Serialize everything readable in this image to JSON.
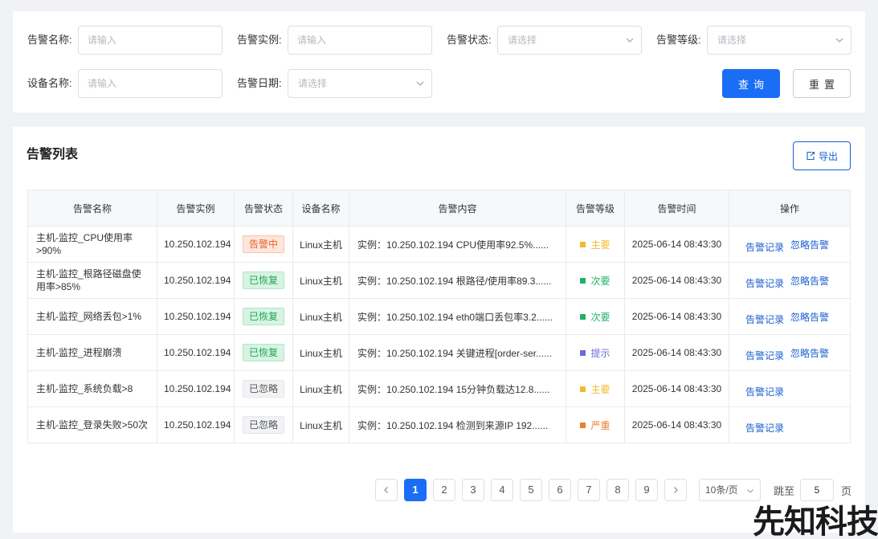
{
  "filters": {
    "alert_name": {
      "label": "告警名称:",
      "placeholder": "请输入"
    },
    "alert_instance": {
      "label": "告警实例:",
      "placeholder": "请输入"
    },
    "alert_status": {
      "label": "告警状态:",
      "placeholder": "请选择"
    },
    "alert_level": {
      "label": "告警等级:",
      "placeholder": "请选择"
    },
    "device_name": {
      "label": "设备名称:",
      "placeholder": "请输入"
    },
    "alert_date": {
      "label": "告警日期:",
      "placeholder": "请选择"
    },
    "query_label": "查询",
    "reset_label": "重置"
  },
  "list": {
    "title": "告警列表",
    "export_label": "导出",
    "columns": [
      "告警名称",
      "告警实例",
      "告警状态",
      "设备名称",
      "告警内容",
      "告警等级",
      "告警时间",
      "操作"
    ],
    "status_colors": {
      "告警中": {
        "bg": "#fde6dc",
        "border": "#f8c4ac",
        "text": "#e8642c"
      },
      "已恢复": {
        "bg": "#d7f3e1",
        "border": "#b3e6c6",
        "text": "#1ea55a"
      },
      "已忽略": {
        "bg": "#f2f3f5",
        "border": "#e4e6ea",
        "text": "#555555"
      }
    },
    "level_colors": {
      "主要": "#f5b82e",
      "次要": "#1fb268",
      "提示": "#6b6bd8",
      "严重": "#f07f2b"
    },
    "rows": [
      {
        "name": "主机-监控_CPU使用率>90%",
        "instance": "10.250.102.194",
        "status": "告警中",
        "device": "Linux主机",
        "content": "实例：10.250.102.194 CPU使用率92.5%......",
        "level": "主要",
        "time": "2025-06-14 08:43:30",
        "ops": [
          "告警记录",
          "忽略告警"
        ]
      },
      {
        "name": "主机-监控_根路径磁盘使用率>85%",
        "instance": "10.250.102.194",
        "status": "已恢复",
        "device": "Linux主机",
        "content": "实例：10.250.102.194 根路径/使用率89.3......",
        "level": "次要",
        "time": "2025-06-14 08:43:30",
        "ops": [
          "告警记录",
          "忽略告警"
        ]
      },
      {
        "name": "主机-监控_网络丢包>1%",
        "instance": "10.250.102.194",
        "status": "已恢复",
        "device": "Linux主机",
        "content": "实例：10.250.102.194 eth0端口丢包率3.2......",
        "level": "次要",
        "time": "2025-06-14 08:43:30",
        "ops": [
          "告警记录",
          "忽略告警"
        ]
      },
      {
        "name": "主机-监控_进程崩溃",
        "instance": "10.250.102.194",
        "status": "已恢复",
        "device": "Linux主机",
        "content": "实例：10.250.102.194 关键进程[order-ser......",
        "level": "提示",
        "time": "2025-06-14 08:43:30",
        "ops": [
          "告警记录",
          "忽略告警"
        ]
      },
      {
        "name": "主机-监控_系统负载>8",
        "instance": "10.250.102.194",
        "status": "已忽略",
        "device": "Linux主机",
        "content": "实例：10.250.102.194 15分钟负载达12.8......",
        "level": "主要",
        "time": "2025-06-14 08:43:30",
        "ops": [
          "告警记录"
        ]
      },
      {
        "name": "主机-监控_登录失败>50次",
        "instance": "10.250.102.194",
        "status": "已忽略",
        "device": "Linux主机",
        "content": "实例：10.250.102.194 检测到来源IP 192......",
        "level": "严重",
        "time": "2025-06-14 08:43:30",
        "ops": [
          "告警记录"
        ]
      }
    ]
  },
  "pagination": {
    "pages": [
      "1",
      "2",
      "3",
      "4",
      "5",
      "6",
      "7",
      "8",
      "9"
    ],
    "current": "1",
    "page_size": "10条/页",
    "jump_label": "跳至",
    "jump_value": "5",
    "unit": "页"
  },
  "watermark": "先知科技"
}
